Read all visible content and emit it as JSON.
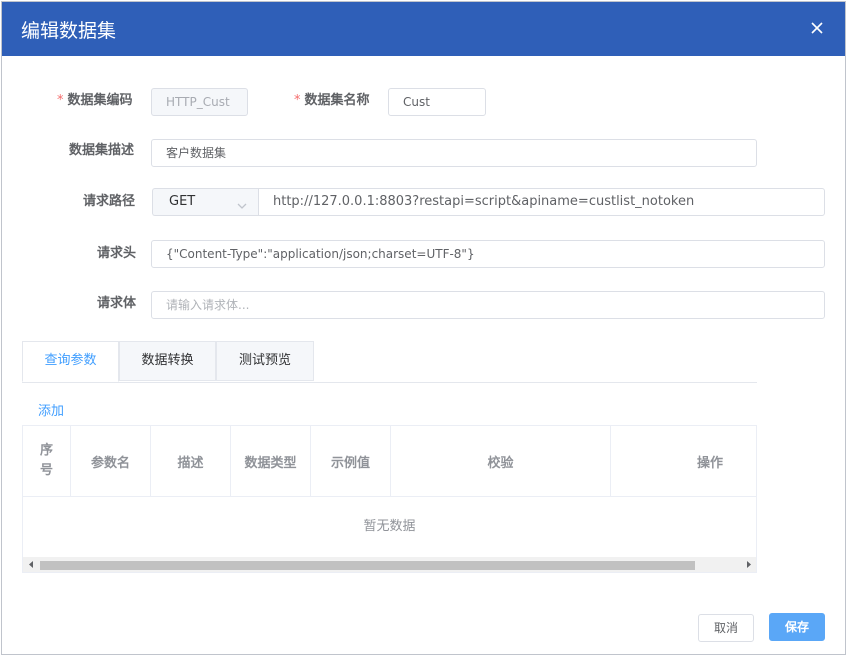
{
  "dialog": {
    "title": "编辑数据集",
    "close_icon": "close-icon"
  },
  "form": {
    "code": {
      "label": "数据集编码",
      "value": "HTTP_Cust",
      "required_mark": "*"
    },
    "name": {
      "label": "数据集名称",
      "value": "Cust",
      "required_mark": "*"
    },
    "description": {
      "label": "数据集描述",
      "value": "客户数据集"
    },
    "request_path": {
      "label": "请求路径",
      "method": "GET",
      "url": "http://127.0.0.1:8803?restapi=script&apiname=custlist_notoken"
    },
    "request_header": {
      "label": "请求头",
      "value": "{\"Content-Type\":\"application/json;charset=UTF-8\"}"
    },
    "request_body": {
      "label": "请求体",
      "placeholder": "请输入请求体..."
    }
  },
  "tabs": [
    {
      "label": "查询参数",
      "active": true
    },
    {
      "label": "数据转换",
      "active": false
    },
    {
      "label": "测试预览",
      "active": false
    }
  ],
  "params": {
    "add_label": "添加",
    "columns": [
      "序号",
      "参数名",
      "描述",
      "数据类型",
      "示例值",
      "校验",
      "操作"
    ],
    "empty_text": "暂无数据"
  },
  "footer": {
    "cancel_label": "取消",
    "save_label": "保存"
  },
  "colors": {
    "header_bg": "#2f5fb8",
    "accent": "#409eff",
    "required": "#f56c6c",
    "save_bg": "#5aa7f7"
  }
}
